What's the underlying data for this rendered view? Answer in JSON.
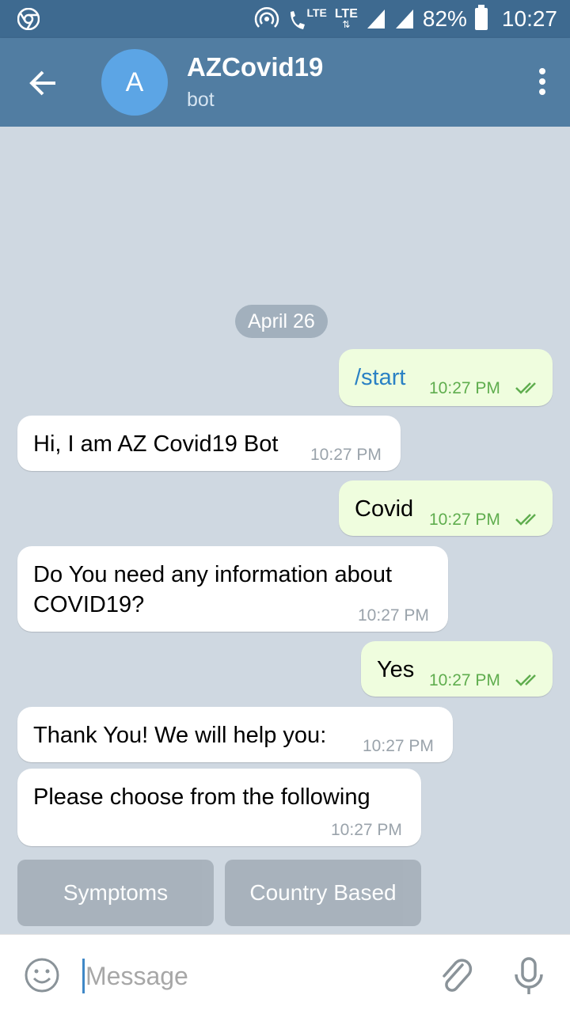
{
  "status_bar": {
    "lte1": "LTE",
    "lte2": "LTE",
    "battery": "82%",
    "time": "10:27"
  },
  "header": {
    "avatar_letter": "A",
    "title": "AZCovid19",
    "subtitle": "bot"
  },
  "chat": {
    "date": "April 26",
    "messages": [
      {
        "dir": "out",
        "text": "/start",
        "time": "10:27 PM"
      },
      {
        "dir": "in",
        "text": "Hi, I am AZ Covid19 Bot",
        "time": "10:27 PM"
      },
      {
        "dir": "out",
        "text": "Covid",
        "time": "10:27 PM"
      },
      {
        "dir": "in",
        "text_line1": "Do You need any information about",
        "text_line2": "COVID19?",
        "time": "10:27 PM"
      },
      {
        "dir": "out",
        "text": "Yes",
        "time": "10:27 PM"
      },
      {
        "dir": "in",
        "text": "Thank You! We will help you:",
        "time": "10:27 PM"
      },
      {
        "dir": "in",
        "text": "Please choose from the following",
        "time": "10:27 PM"
      }
    ],
    "keyboard": [
      "Symptoms",
      "Country Based"
    ]
  },
  "input": {
    "placeholder": "Message"
  },
  "colors": {
    "header": "#517da2",
    "status_bar": "#3e6a90",
    "chat_bg": "#cfd8e1",
    "outgoing_bubble": "#effdde",
    "incoming_bubble": "#ffffff",
    "accent": "#5ca5e5"
  }
}
